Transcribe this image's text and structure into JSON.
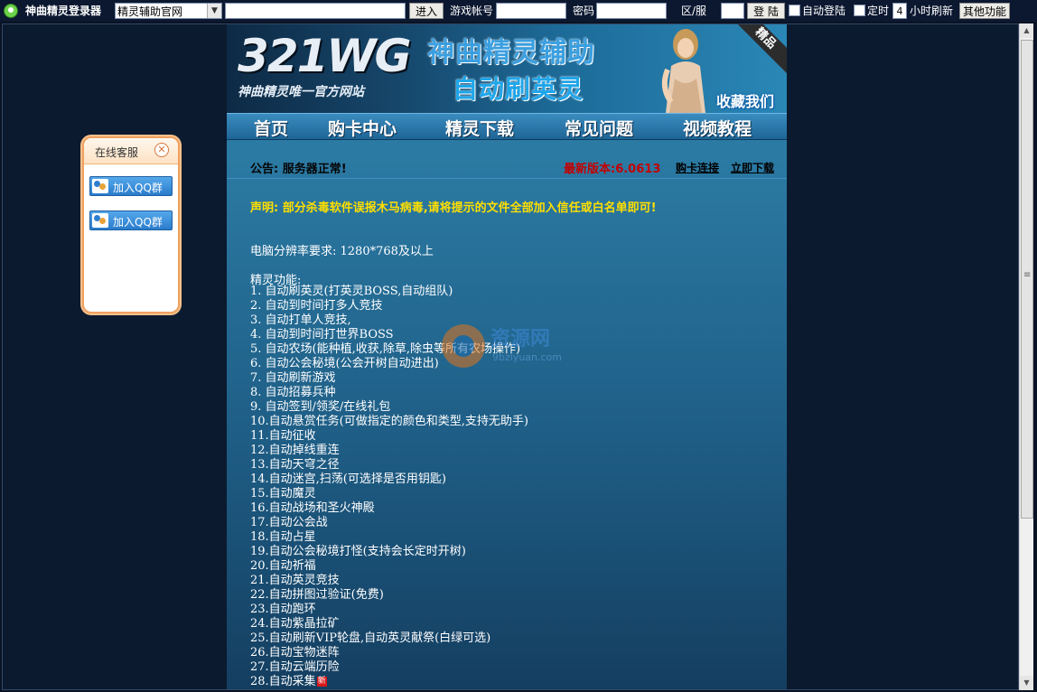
{
  "toolbar": {
    "app_title": "神曲精灵登录器",
    "site_select": "精灵辅助官网",
    "url_value": "",
    "go_label": "进入",
    "account_label": "游戏帐号",
    "password_label": "密码",
    "zone_label": "区/服",
    "login_label": "登 陆",
    "auto_login_label": "自动登陆",
    "timer_label": "定时",
    "hours_value": "4",
    "hours_label": "小时刷新",
    "other_label": "其他功能"
  },
  "banner": {
    "logo": "321WG",
    "logo_sub": "神曲精灵唯一官方网站",
    "title1": "神曲精灵辅助",
    "title2": "自动刷英灵",
    "ribbon": "精品",
    "fav": "收藏我们"
  },
  "nav": [
    "首页",
    "购卡中心",
    "精灵下载",
    "常见问题",
    "视频教程"
  ],
  "notice": {
    "text": "公告: 服务器正常!",
    "version": "最新版本:6.0613",
    "buy_link": "购卡连接",
    "download_link": "立即下载"
  },
  "disclaimer": "声明: 部分杀毒软件误报木马病毒,请将提示的文件全部加入信任或白名单即可!",
  "resolution": "电脑分辨率要求: 1280*768及以上",
  "features_title": "精灵功能:",
  "features": [
    "1. 自动刷英灵(打英灵BOSS,自动组队)",
    "2. 自动到时间打多人竞技",
    "3. 自动打单人竞技,",
    "4. 自动到时间打世界BOSS",
    "5. 自动农场(能种植,收获,除草,除虫等所有农场操作)",
    "6. 自动公会秘境(公会开树自动进出)",
    "7. 自动刷新游戏",
    "8. 自动招募兵种",
    "9. 自动签到/领奖/在线礼包",
    "10.自动悬赏任务(可做指定的颜色和类型,支持无助手)",
    "11.自动征收",
    "12.自动掉线重连",
    "13.自动天穹之径",
    "14.自动迷宫,扫荡(可选择是否用钥匙)",
    "15.自动魔灵",
    "16.自动战场和圣火神殿",
    "17.自动公会战",
    "18.自动占星",
    "19.自动公会秘境打怪(支持会长定时开树)",
    "20.自动祈福",
    "21.自动英灵竞技",
    "22.自动拼图过验证(免费)",
    "23.自动跑环",
    "24.自动紫晶拉矿",
    "25.自动刷新VIP轮盘,自动英灵献祭(白绿可选)",
    "26.自动宝物迷阵",
    "27.自动云端历险",
    "28.自动采集"
  ],
  "new_badge": "新",
  "watermark": {
    "title": "资源网",
    "sub": "9bziyuan.com"
  },
  "cs": {
    "title": "在线客服",
    "qq1": "加入QQ群",
    "qq2": "加入QQ群"
  }
}
